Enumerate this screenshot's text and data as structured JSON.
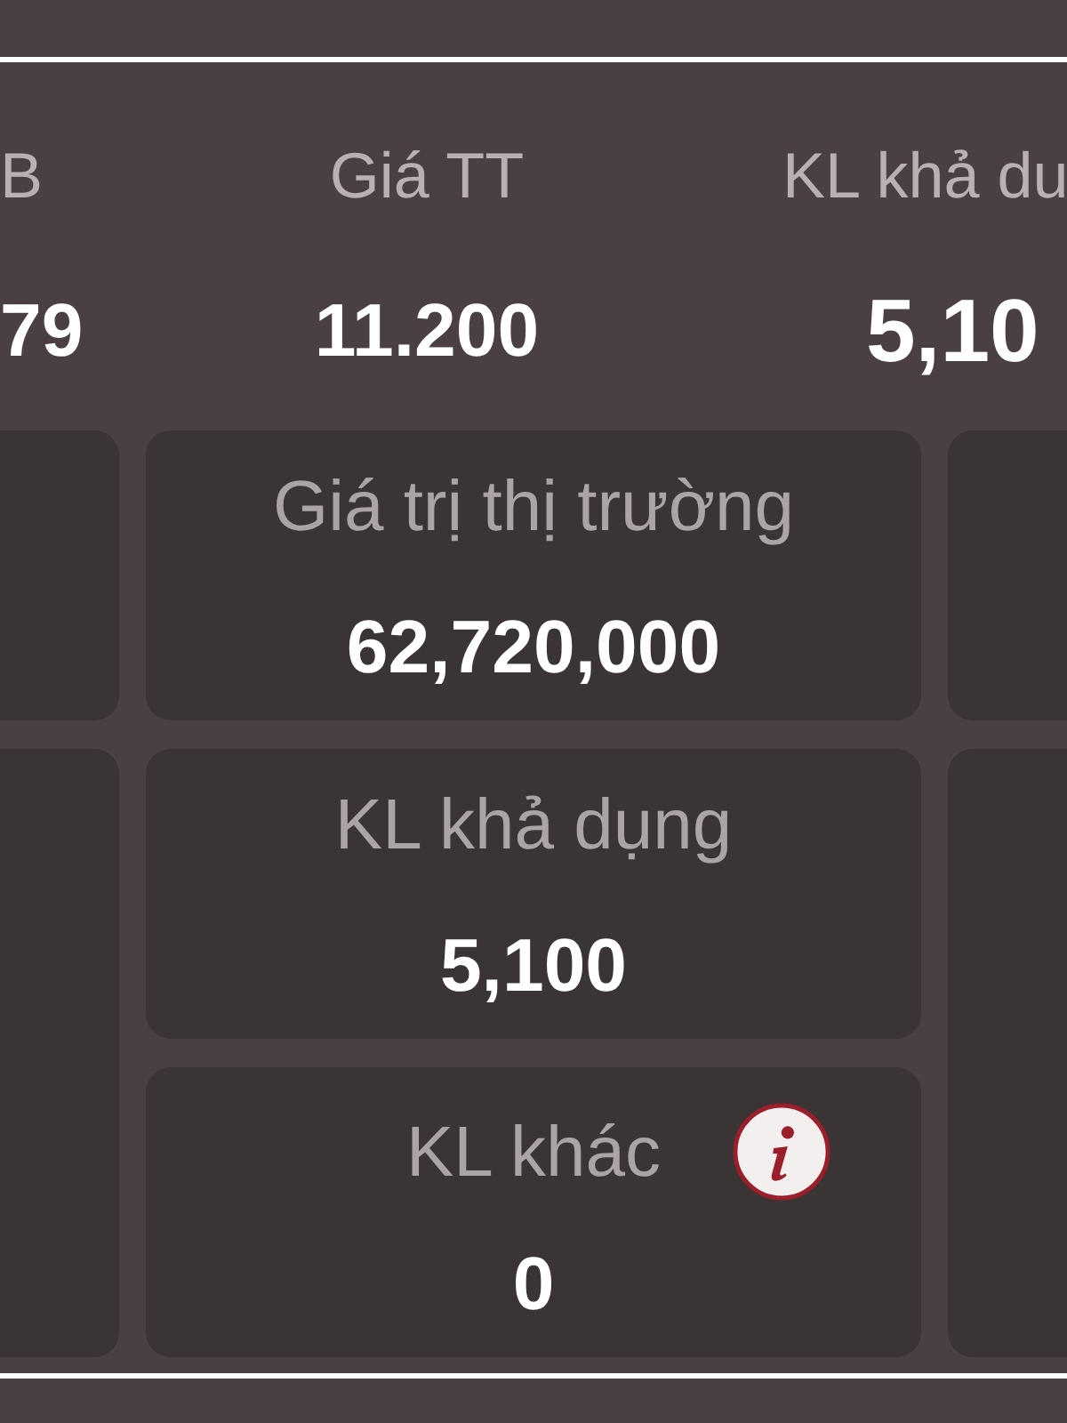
{
  "summary_columns": [
    {
      "label": "B",
      "value": "79"
    },
    {
      "label": "Giá TT",
      "value": "11.200"
    },
    {
      "label": "KL khả du",
      "value": "5,10"
    }
  ],
  "cards": [
    {
      "label": "Giá trị thị trường",
      "value": "62,720,000",
      "info": false
    },
    {
      "label": "KL khả dụng",
      "value": "5,100",
      "info": false
    },
    {
      "label": "KL khác",
      "value": "0",
      "info": true
    }
  ]
}
